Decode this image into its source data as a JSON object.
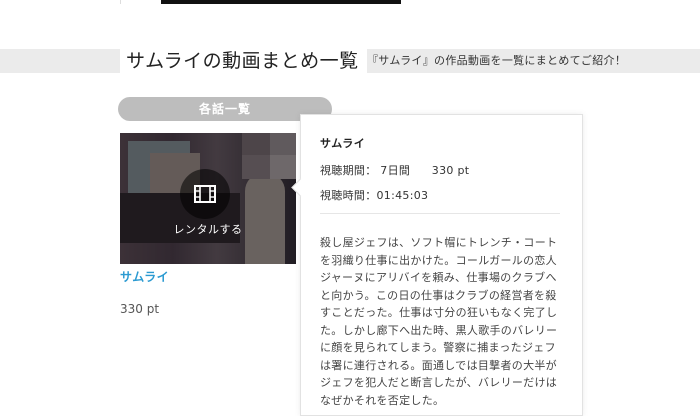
{
  "page": {
    "title": "サムライの動画まとめ一覧",
    "subtitle": "『サムライ』の作品動画を一覧にまとめてご紹介！"
  },
  "section": {
    "label": "各話一覧"
  },
  "item": {
    "title": "サムライ",
    "price": "330 pt",
    "rent_label": "レンタルする",
    "thumb_icon": "film-icon"
  },
  "popup": {
    "title": "サムライ",
    "period_label": "視聴期間：",
    "period_value": "7日間",
    "period_price": "330 pt",
    "duration_label": "視聴時間：",
    "duration_value": "01:45:03",
    "synopsis": "殺し屋ジェフは、ソフト帽にトレンチ・コートを羽織り仕事に出かけた。コールガールの恋人ジャーヌにアリバイを頼み、仕事場のクラブへと向かう。この日の仕事はクラブの経営者を殺すことだった。仕事は寸分の狂いもなく完了した。しかし廊下へ出た時、黒人歌手のバレリーに顔を見られてしまう。警察に捕まったジェフは署に連行される。面通しでは目撃者の大半がジェフを犯人だと断言したが、バレリーだけはなぜかそれを否定した。"
  },
  "colors": {
    "accent_link": "#2b9ad1",
    "pill_bg": "#bdbdbd",
    "header_band": "#ebebeb"
  }
}
